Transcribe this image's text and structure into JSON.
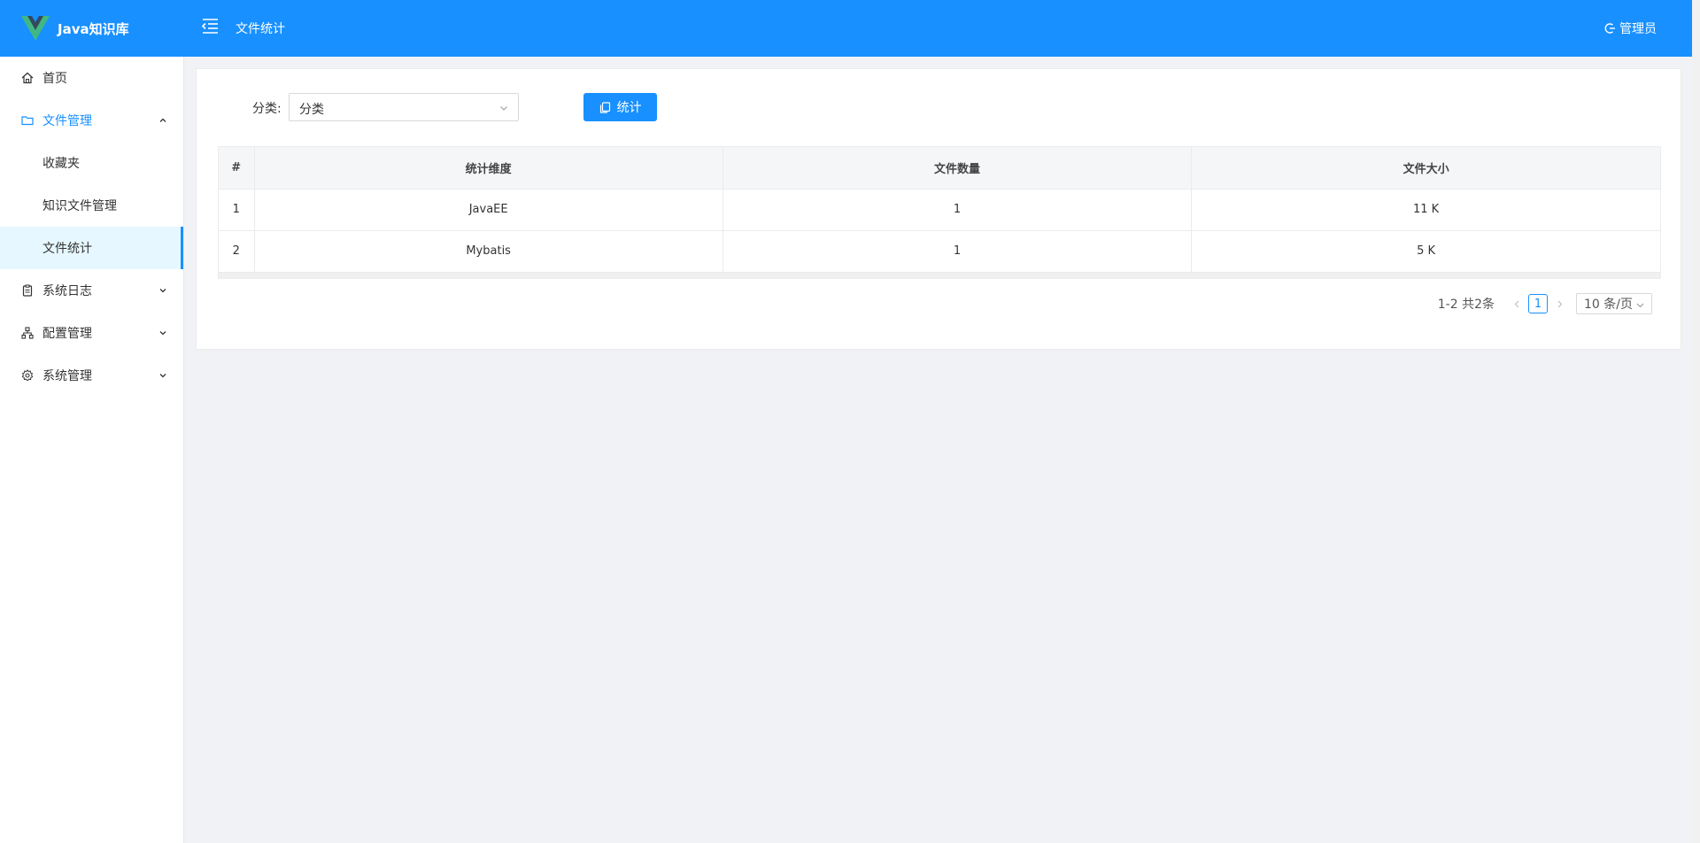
{
  "app": {
    "name": "Java知识库",
    "page_title": "文件统计",
    "user": "管理员",
    "accent_color": "#1890ff"
  },
  "sidebar": {
    "items": [
      {
        "label": "首页",
        "icon": "home-icon"
      },
      {
        "label": "文件管理",
        "icon": "folder-icon",
        "expanded": true,
        "children": [
          {
            "label": "收藏夹"
          },
          {
            "label": "知识文件管理"
          },
          {
            "label": "文件统计",
            "selected": true
          }
        ]
      },
      {
        "label": "系统日志",
        "icon": "clipboard-icon"
      },
      {
        "label": "配置管理",
        "icon": "sitemap-icon"
      },
      {
        "label": "系统管理",
        "icon": "gear-icon"
      }
    ]
  },
  "filter": {
    "label": "分类:",
    "select_value": "分类",
    "button_label": "统计"
  },
  "table": {
    "headers": [
      "#",
      "统计维度",
      "文件数量",
      "文件大小"
    ],
    "rows": [
      [
        "1",
        "JavaEE",
        "1",
        "11 K"
      ],
      [
        "2",
        "Mybatis",
        "1",
        "5 K"
      ]
    ]
  },
  "pagination": {
    "total_text": "1-2 共2条",
    "current_page": "1",
    "page_size": "10 条/页"
  }
}
